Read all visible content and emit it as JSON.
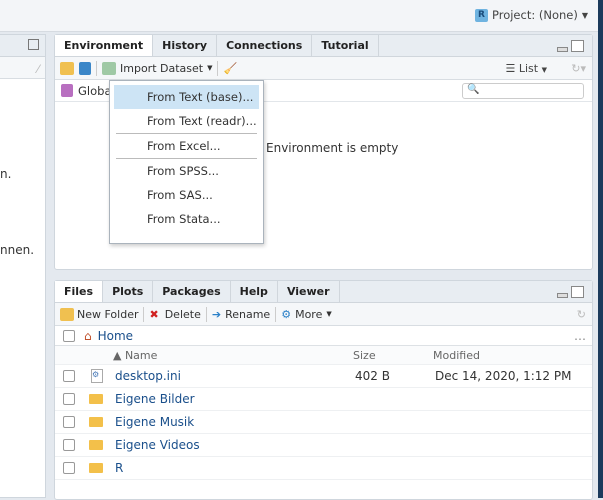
{
  "topbar": {
    "project": "Project: (None)"
  },
  "left": {
    "fragments": [
      "n.",
      "nnen."
    ]
  },
  "env": {
    "tabs": [
      "Environment",
      "History",
      "Connections",
      "Tutorial"
    ],
    "import_label": "Import Dataset",
    "list_label": "List",
    "global_label": "Globa",
    "empty": "Environment is empty"
  },
  "import_menu": {
    "items": [
      "From Text (base)...",
      "From Text (readr)...",
      "From Excel...",
      "From SPSS...",
      "From SAS...",
      "From Stata..."
    ]
  },
  "files": {
    "tabs": [
      "Files",
      "Plots",
      "Packages",
      "Help",
      "Viewer"
    ],
    "toolbar": {
      "new_folder": "New Folder",
      "delete": "Delete",
      "rename": "Rename",
      "more": "More"
    },
    "breadcrumb": "Home",
    "columns": [
      "▲ Name",
      "Size",
      "Modified"
    ],
    "rows": [
      {
        "name": "desktop.ini",
        "size": "402 B",
        "modified": "Dec 14, 2020, 1:12 PM"
      },
      {
        "name": "Eigene Bilder",
        "size": "",
        "modified": ""
      },
      {
        "name": "Eigene Musik",
        "size": "",
        "modified": ""
      },
      {
        "name": "Eigene Videos",
        "size": "",
        "modified": ""
      },
      {
        "name": "R",
        "size": "",
        "modified": ""
      }
    ]
  }
}
